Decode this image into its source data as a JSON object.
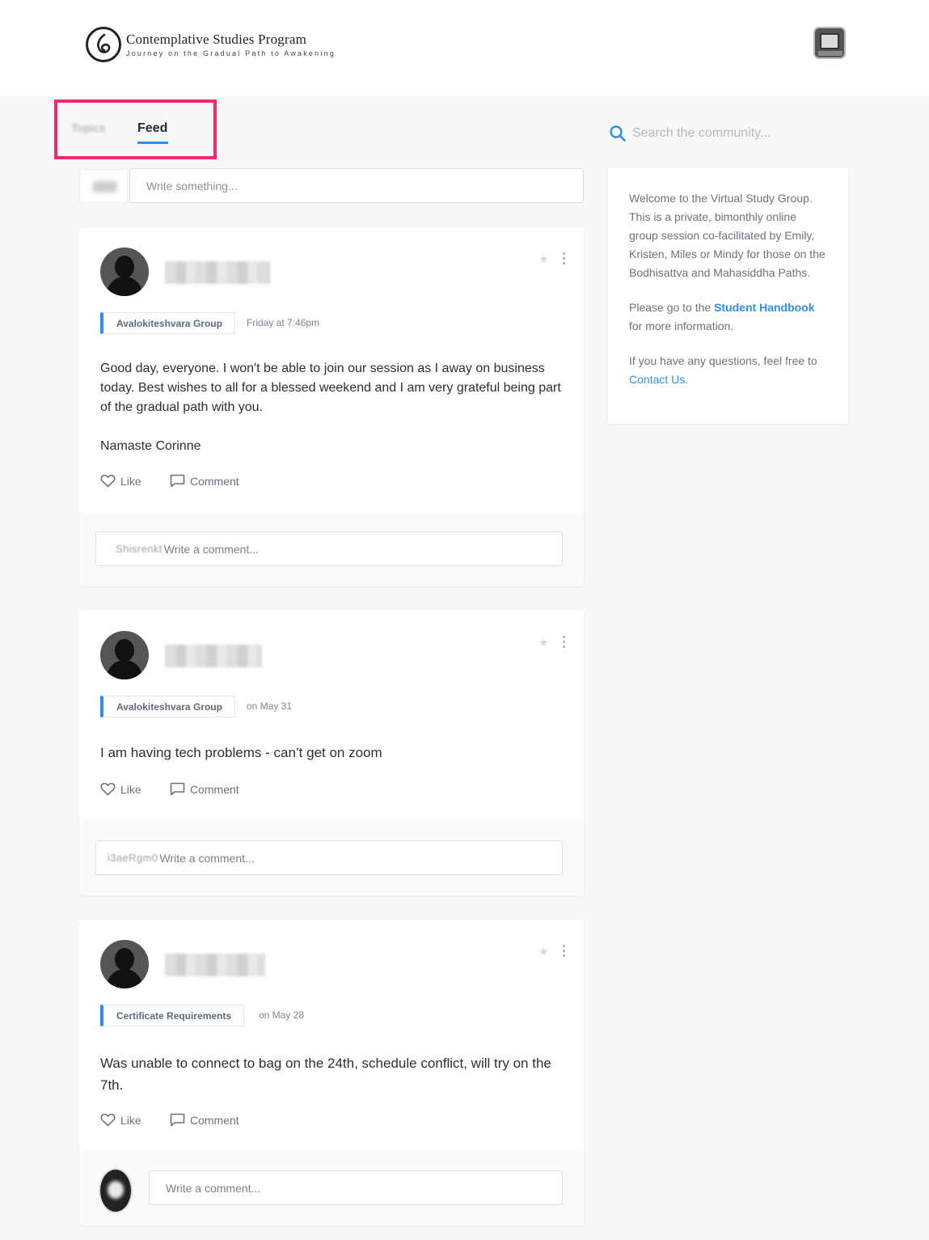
{
  "header": {
    "brand_title": "Contemplative Studies Program",
    "brand_tagline": "Journey on the Gradual Path to Awakening"
  },
  "tabs": {
    "topics_label": "Topics",
    "feed_label": "Feed"
  },
  "composer": {
    "placeholder": "Write something..."
  },
  "search": {
    "placeholder": "Search the community..."
  },
  "sidebar": {
    "welcome_text": "Welcome to the Virtual Study Group. This is a private, bimonthly online group session co-facilitated by Emily, Kristen, Miles or Mindy for those on the Bodhisattva and Mahasiddha Paths.",
    "handbook_prefix": "Please go to the ",
    "handbook_link": "Student Handbook",
    "handbook_suffix": " for more information.",
    "contact_prefix": "If you have any questions, feel free to ",
    "contact_link": "Contact Us",
    "contact_suffix": "."
  },
  "posts": [
    {
      "group": "Avalokiteshvara Group",
      "time": "Friday at 7:46pm",
      "paragraphs": [
        "Good day, everyone.  I won't be able to join our session as I away on business today.  Best wishes to all for a blessed weekend and I am very grateful being part of the gradual path with you.",
        "Namaste Corinne"
      ],
      "like_label": "Like",
      "comment_label": "Comment",
      "commenter": "Shisrenkt",
      "comment_placeholder": "Write a comment..."
    },
    {
      "group": "Avalokiteshvara Group",
      "time": "on May 31",
      "paragraphs": [
        "I am having tech problems - can’t get on zoom"
      ],
      "like_label": "Like",
      "comment_label": "Comment",
      "commenter": "i3aeRgm0",
      "comment_placeholder": "Write a comment..."
    },
    {
      "group": "Certificate Requirements",
      "time": "on May 28",
      "paragraphs": [
        "Was unable to connect to bag on the 24th, schedule conflict, will try on the 7th."
      ],
      "like_label": "Like",
      "comment_label": "Comment",
      "comment_placeholder": "Write a comment..."
    }
  ],
  "colors": {
    "accent": "#2e8fe8",
    "highlight": "#ee2a6c",
    "page_bg": "#f8f8f9"
  }
}
